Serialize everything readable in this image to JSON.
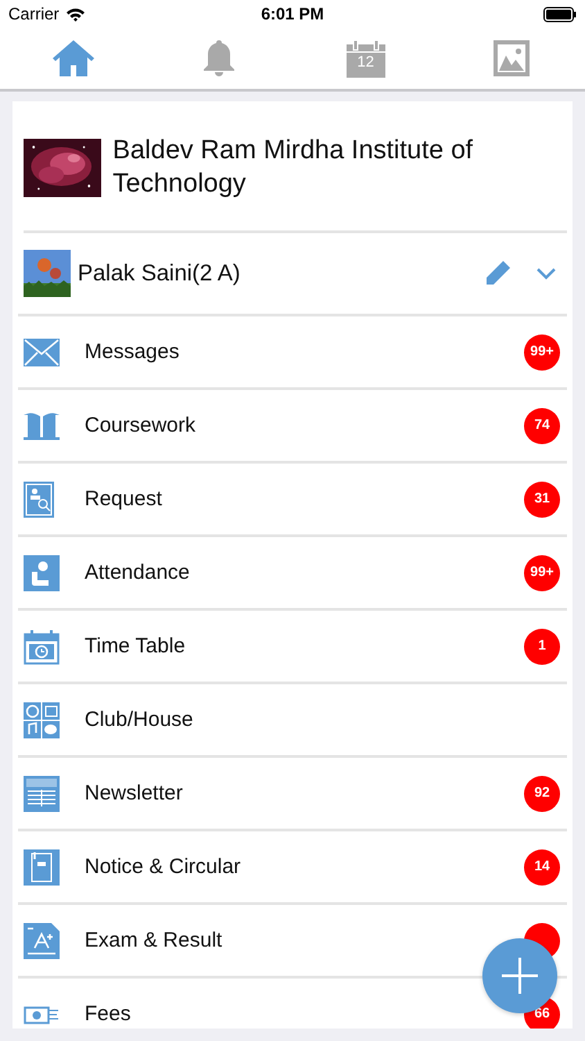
{
  "status_bar": {
    "carrier": "Carrier",
    "time": "6:01 PM"
  },
  "tabs": [
    {
      "kind": "home",
      "selected": true
    },
    {
      "kind": "bell",
      "selected": false
    },
    {
      "kind": "calendar",
      "selected": false,
      "day": "12"
    },
    {
      "kind": "gallery",
      "selected": false
    }
  ],
  "school": {
    "name": "Baldev Ram Mirdha Institute of Technology"
  },
  "profile": {
    "name": "Palak Saini(2 A)"
  },
  "menu": [
    {
      "kind": "mail",
      "label": "Messages",
      "count": "99+"
    },
    {
      "kind": "book",
      "label": "Coursework",
      "count": "74"
    },
    {
      "kind": "request",
      "label": "Request",
      "count": "31"
    },
    {
      "kind": "attendance",
      "label": "Attendance",
      "count": "99+"
    },
    {
      "kind": "timetable",
      "label": "Time Table",
      "count": "1"
    },
    {
      "kind": "club",
      "label": "Club/House"
    },
    {
      "kind": "news",
      "label": "Newsletter",
      "count": "92"
    },
    {
      "kind": "notice",
      "label": "Notice & Circular",
      "count": "14"
    },
    {
      "kind": "exam",
      "label": "Exam & Result",
      "badge_covered": true
    },
    {
      "kind": "fees",
      "label": "Fees",
      "count": "66"
    }
  ]
}
